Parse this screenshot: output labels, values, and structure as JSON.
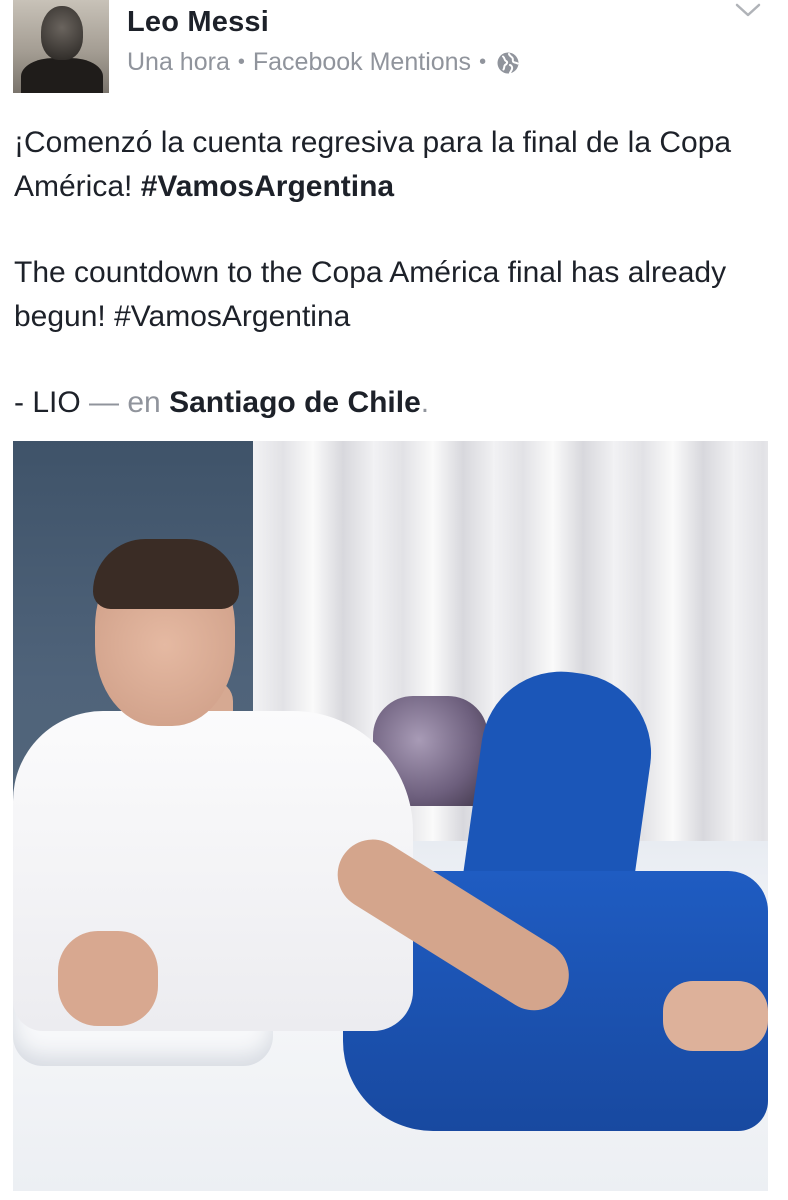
{
  "post": {
    "author": "Leo Messi",
    "time": "Una hora",
    "separator": "•",
    "source": "Facebook Mentions",
    "privacy_icon": "globe-icon",
    "menu_icon": "chevron-down-icon",
    "line_es": "¡Comenzó la cuenta regresiva para la final de la Copa América! ",
    "hashtag_es": "#VamosArgentina",
    "line_en": "The countdown to the Copa América final has already begun! #VamosArgentina",
    "signature": "- LIO",
    "dash": " — ",
    "location_prefix": "en ",
    "location": "Santiago de Chile",
    "period": "."
  },
  "colors": {
    "text": "#1d2129",
    "muted": "#90949c"
  }
}
